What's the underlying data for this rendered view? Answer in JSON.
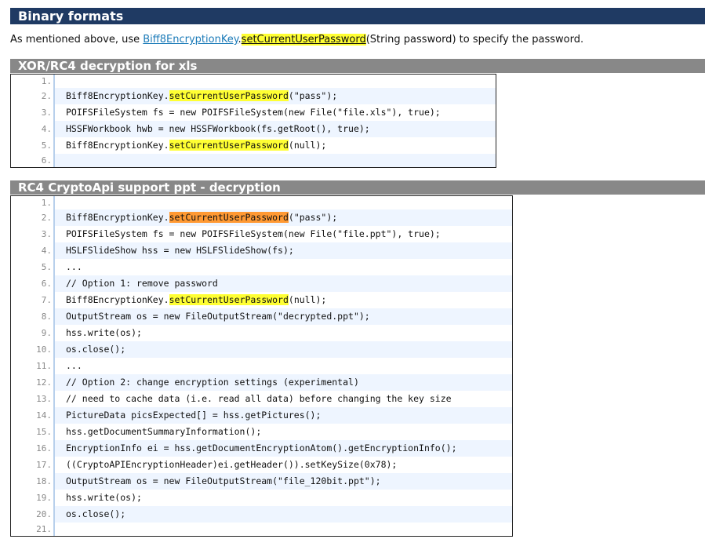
{
  "heading": "Binary formats",
  "intro": {
    "prefix": "As mentioned above, use ",
    "link": "Biff8EncryptionKey",
    "dot": ".",
    "method": "setCurrentUserPassword",
    "suffix": "(String password) to specify the password."
  },
  "sections": [
    {
      "title": "XOR/RC4 decryption for xls",
      "lines": [
        {
          "n": "1.",
          "parts": []
        },
        {
          "n": "2.",
          "parts": [
            {
              "t": "Biff8EncryptionKey."
            },
            {
              "t": "setCurrentUserPassword",
              "h": "y"
            },
            {
              "t": "(\"pass\");"
            }
          ]
        },
        {
          "n": "3.",
          "parts": [
            {
              "t": "POIFSFileSystem fs = new POIFSFileSystem(new File(\"file.xls\"), true);"
            }
          ]
        },
        {
          "n": "4.",
          "parts": [
            {
              "t": "HSSFWorkbook hwb = new HSSFWorkbook(fs.getRoot(), true);"
            }
          ]
        },
        {
          "n": "5.",
          "parts": [
            {
              "t": "Biff8EncryptionKey."
            },
            {
              "t": "setCurrentUserPassword",
              "h": "y"
            },
            {
              "t": "(null);"
            }
          ]
        },
        {
          "n": "6.",
          "parts": []
        }
      ]
    },
    {
      "title": "RC4 CryptoApi support ppt - decryption",
      "lines": [
        {
          "n": "1.",
          "parts": []
        },
        {
          "n": "2.",
          "parts": [
            {
              "t": "Biff8EncryptionKey."
            },
            {
              "t": "setCurrentUserPassword",
              "h": "o"
            },
            {
              "t": "(\"pass\");"
            }
          ]
        },
        {
          "n": "3.",
          "parts": [
            {
              "t": "POIFSFileSystem fs = new POIFSFileSystem(new File(\"file.ppt\"), true);"
            }
          ]
        },
        {
          "n": "4.",
          "parts": [
            {
              "t": "HSLFSlideShow hss = new HSLFSlideShow(fs);"
            }
          ]
        },
        {
          "n": "5.",
          "parts": [
            {
              "t": "..."
            }
          ]
        },
        {
          "n": "6.",
          "parts": [
            {
              "t": "// Option 1: remove password"
            }
          ]
        },
        {
          "n": "7.",
          "parts": [
            {
              "t": "Biff8EncryptionKey."
            },
            {
              "t": "setCurrentUserPassword",
              "h": "y"
            },
            {
              "t": "(null);"
            }
          ]
        },
        {
          "n": "8.",
          "parts": [
            {
              "t": "OutputStream os = new FileOutputStream(\"decrypted.ppt\");"
            }
          ]
        },
        {
          "n": "9.",
          "parts": [
            {
              "t": "hss.write(os);"
            }
          ]
        },
        {
          "n": "10.",
          "parts": [
            {
              "t": "os.close();"
            }
          ]
        },
        {
          "n": "11.",
          "parts": [
            {
              "t": "..."
            }
          ]
        },
        {
          "n": "12.",
          "parts": [
            {
              "t": "// Option 2: change encryption settings (experimental)"
            }
          ]
        },
        {
          "n": "13.",
          "parts": [
            {
              "t": "// need to cache data (i.e. read all data) before changing the key size"
            }
          ]
        },
        {
          "n": "14.",
          "parts": [
            {
              "t": "PictureData picsExpected[] = hss.getPictures();"
            }
          ]
        },
        {
          "n": "15.",
          "parts": [
            {
              "t": "hss.getDocumentSummaryInformation();"
            }
          ]
        },
        {
          "n": "16.",
          "parts": [
            {
              "t": "EncryptionInfo ei = hss.getDocumentEncryptionAtom().getEncryptionInfo();"
            }
          ]
        },
        {
          "n": "17.",
          "parts": [
            {
              "t": "((CryptoAPIEncryptionHeader)ei.getHeader()).setKeySize(0x78);"
            }
          ]
        },
        {
          "n": "18.",
          "parts": [
            {
              "t": "OutputStream os = new FileOutputStream(\"file_120bit.ppt\");"
            }
          ]
        },
        {
          "n": "19.",
          "parts": [
            {
              "t": "hss.write(os);"
            }
          ]
        },
        {
          "n": "20.",
          "parts": [
            {
              "t": "os.close();"
            }
          ]
        },
        {
          "n": "21.",
          "parts": []
        }
      ]
    }
  ],
  "colors": {
    "highlight": "#ffff33",
    "highlight_active": "#ff9933",
    "header": "#1f3a63",
    "subheader": "#888888"
  }
}
